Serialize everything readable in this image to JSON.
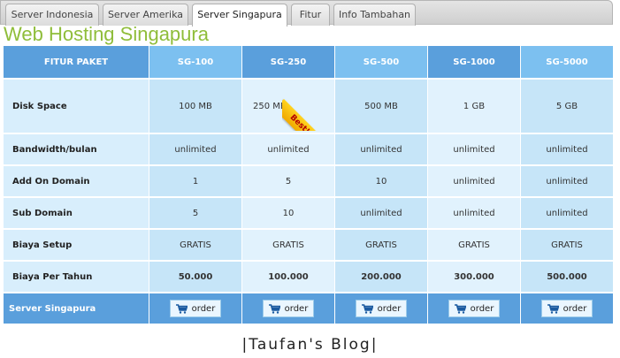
{
  "tabs": [
    {
      "label": "Server Indonesia",
      "active": false
    },
    {
      "label": "Server Amerika",
      "active": false
    },
    {
      "label": "Server Singapura",
      "active": true
    },
    {
      "label": "Fitur",
      "active": false
    },
    {
      "label": "Info Tambahan",
      "active": false
    }
  ],
  "heading": "Web Hosting Singapura",
  "table": {
    "corner_label": "FITUR PAKET",
    "plans": [
      "SG-100",
      "SG-250",
      "SG-500",
      "SG-1000",
      "SG-5000"
    ],
    "rows": [
      {
        "label": "Disk Space",
        "values": [
          "100 MB",
          "250 MB",
          "500 MB",
          "1 GB",
          "5 GB"
        ]
      },
      {
        "label": "Bandwidth/bulan",
        "values": [
          "unlimited",
          "unlimited",
          "unlimited",
          "unlimited",
          "unlimited"
        ]
      },
      {
        "label": "Add On Domain",
        "values": [
          "1",
          "5",
          "10",
          "unlimited",
          "unlimited"
        ]
      },
      {
        "label": "Sub Domain",
        "values": [
          "5",
          "10",
          "unlimited",
          "unlimited",
          "unlimited"
        ]
      },
      {
        "label": "Biaya Setup",
        "values": [
          "GRATIS",
          "GRATIS",
          "GRATIS",
          "GRATIS",
          "GRATIS"
        ]
      },
      {
        "label": "Biaya Per Tahun",
        "values": [
          "50.000",
          "100.000",
          "200.000",
          "300.000",
          "500.000"
        ]
      }
    ],
    "footer_label": "Server Singapura",
    "order_label": "order"
  },
  "best_badge": "Best!",
  "credit": "|Taufan's Blog|",
  "colors": {
    "heading": "#8fbd3a",
    "header_dark": "#5a9fdc",
    "header_light": "#7cc0f0",
    "badge": "#f5b800"
  },
  "icons": {
    "order": "cart-icon"
  }
}
